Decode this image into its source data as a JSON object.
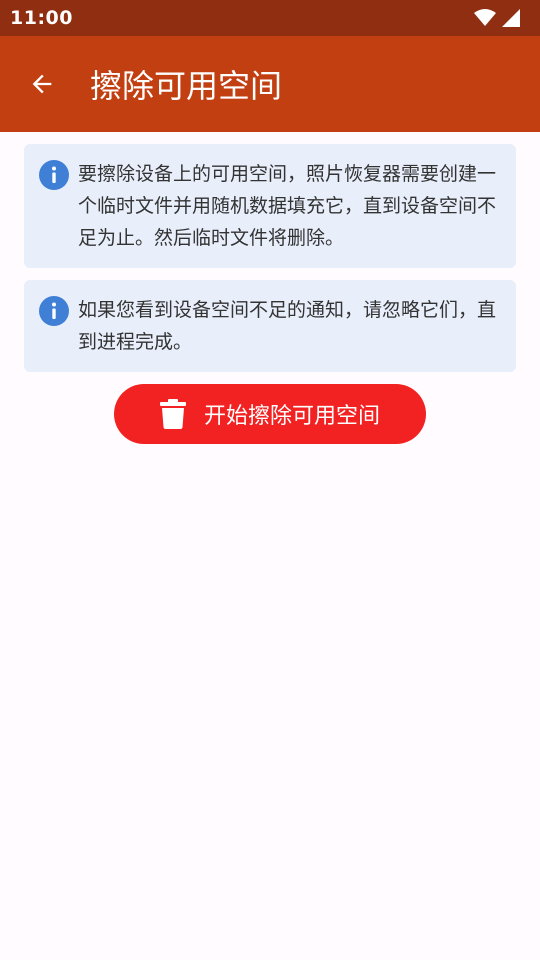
{
  "status_bar": {
    "time": "11:00",
    "icons": [
      "wifi-icon",
      "signal-icon"
    ]
  },
  "app_bar": {
    "back_icon": "arrow-left-icon",
    "title": "擦除可用空间"
  },
  "info_cards": [
    {
      "icon": "info-icon",
      "text": "要擦除设备上的可用空间，照片恢复器需要创建一个临时文件并用随机数据填充它，直到设备空间不足为止。然后临时文件将删除。"
    },
    {
      "icon": "info-icon",
      "text": "如果您看到设备空间不足的通知，请忽略它们，直到进程完成。"
    }
  ],
  "action": {
    "icon": "trash-icon",
    "label": "开始擦除可用空间"
  },
  "colors": {
    "status_bar": "#8f2e10",
    "app_bar": "#c23f12",
    "card_bg": "#e8effb",
    "info_icon": "#3f7fd6",
    "button": "#f22222",
    "background": "#fffbfe"
  }
}
